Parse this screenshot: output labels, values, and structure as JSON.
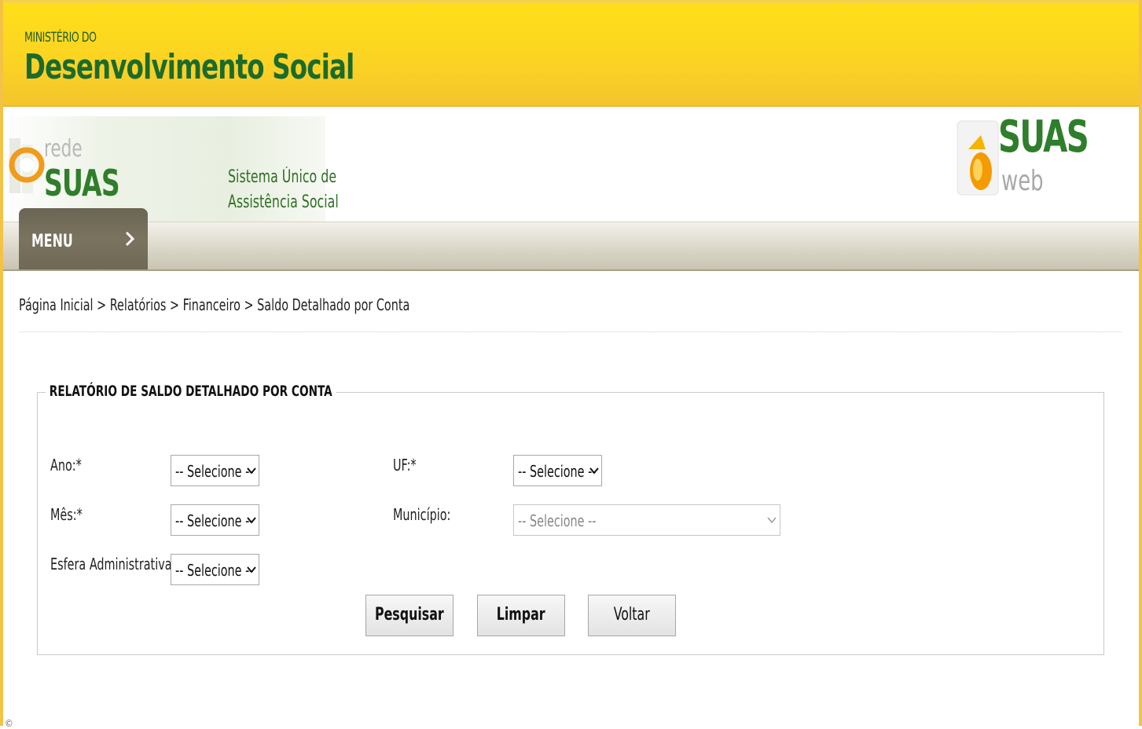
{
  "ministry": {
    "small_label": "MINISTÉRIO DO",
    "name": "Desenvolvimento Social"
  },
  "brand": {
    "rede_label": "rede",
    "suas_label": "SUAS",
    "sistema_line1": "Sistema Único de",
    "sistema_line2": "Assistência Social",
    "suasweb_suas": "SUAS",
    "suasweb_web": "web"
  },
  "menu": {
    "label": "MENU",
    "icon": "chevron-right-icon"
  },
  "breadcrumb": "Página Inicial > Relatórios > Financeiro > Saldo Detalhado por Conta",
  "form": {
    "title": "RELATÓRIO DE SALDO DETALHADO POR CONTA",
    "ano": {
      "label": "Ano:*",
      "value": "-- Selecione --"
    },
    "uf": {
      "label": "UF:*",
      "value": "-- Selecione --"
    },
    "mes": {
      "label": "Mês:*",
      "value": "-- Selecione --"
    },
    "municipio": {
      "label": "Município:",
      "value": "-- Selecione --"
    },
    "esfera": {
      "label": "Esfera Administrativa:*",
      "value": "-- Selecione --"
    }
  },
  "buttons": {
    "pesquisar": "Pesquisar",
    "limpar": "Limpar",
    "voltar": "Voltar"
  },
  "footer": {
    "icon": "copyright-icon"
  },
  "colors": {
    "header_yellow": "#ffe017",
    "brand_green": "#2f7e2b",
    "menu_bg": "#6b6555"
  }
}
